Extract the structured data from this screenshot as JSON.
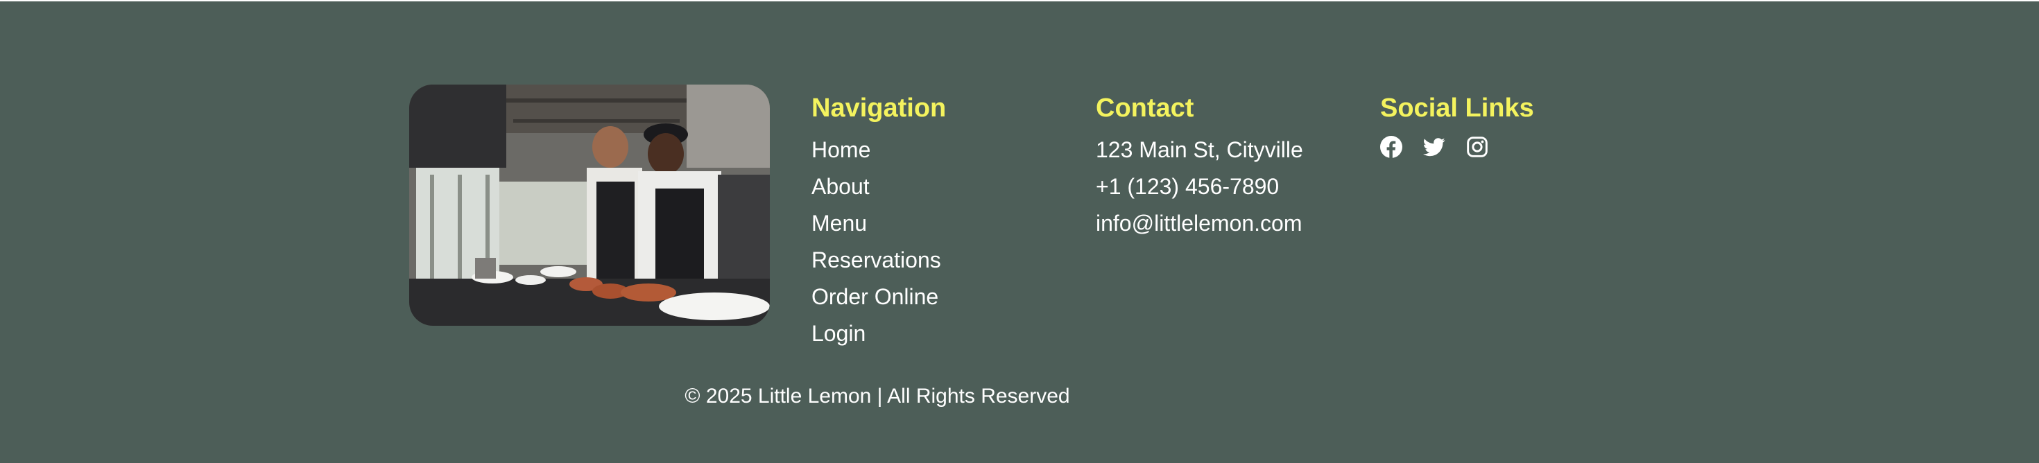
{
  "colors": {
    "footer_bg": "#4d5e58",
    "heading": "#f4f35e",
    "text": "#ffffff"
  },
  "image": {
    "icon": "chefs-in-kitchen-photo"
  },
  "navigation": {
    "heading": "Navigation",
    "links": [
      "Home",
      "About",
      "Menu",
      "Reservations",
      "Order Online",
      "Login"
    ]
  },
  "contact": {
    "heading": "Contact",
    "address": "123 Main St, Cityville",
    "phone": "+1 (123) 456-7890",
    "email": "info@littlelemon.com"
  },
  "social": {
    "heading": "Social Links",
    "icons": [
      "facebook-icon",
      "twitter-icon",
      "instagram-icon"
    ]
  },
  "copyright": "© 2025 Little Lemon | All Rights Reserved"
}
